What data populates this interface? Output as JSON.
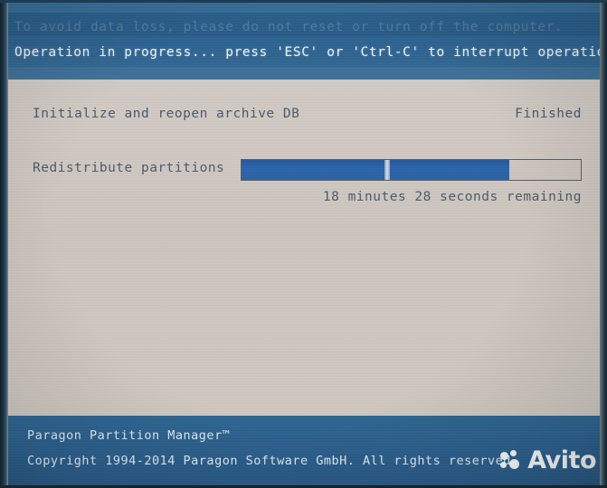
{
  "app": {
    "product_name": "Paragon Partition Manager™",
    "copyright": "Copyright 1994-2014 Paragon Software GmbH. All rights reserved."
  },
  "header": {
    "warning_line": "To avoid data loss, please do not reset or turn off the computer.",
    "instruction_line": "Operation in progress... press 'ESC' or 'Ctrl-C' to interrupt operation"
  },
  "tasks": [
    {
      "label": "Initialize and reopen archive DB",
      "status": "Finished"
    },
    {
      "label": "Redistribute partitions",
      "status": ""
    }
  ],
  "progress": {
    "percent": 79,
    "notch_percent": 42,
    "remaining_text": "18 minutes 28 seconds remaining"
  },
  "watermark": {
    "brand": "Avito",
    "logo_icon": "avito-dots-icon"
  },
  "colors": {
    "header_blue": "#2e6391",
    "footer_blue": "#2b5f8c",
    "panel_gray": "#cdc6bf",
    "progress_blue": "#2a63ad",
    "text_blue_gray": "#4b5b6b",
    "header_text": "#e9f1f6"
  }
}
